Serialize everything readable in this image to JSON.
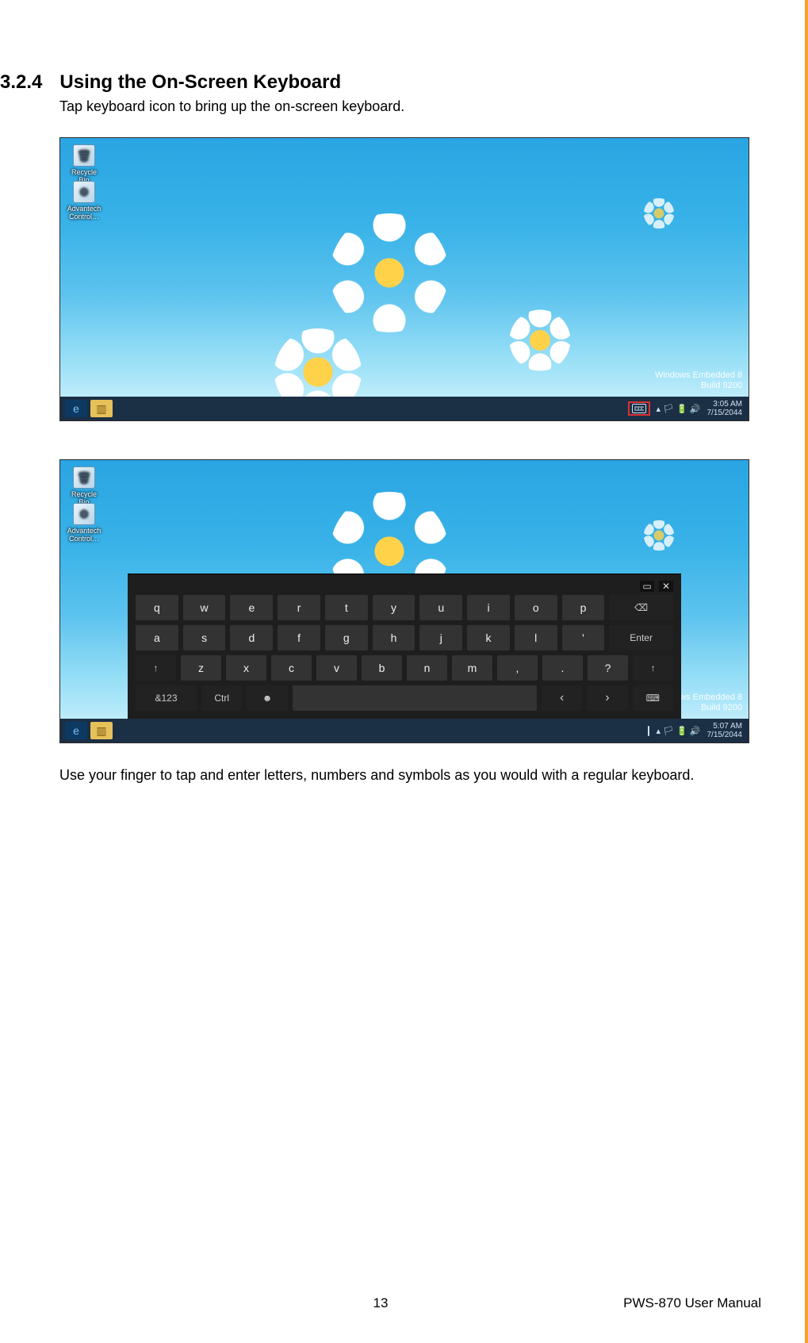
{
  "section": {
    "number": "3.2.4",
    "title": "Using the On-Screen Keyboard"
  },
  "intro": "Tap keyboard icon to bring up the on-screen keyboard.",
  "closing": "Use your finger to tap and enter letters, numbers and symbols as you would with a regular keyboard.",
  "desktop": {
    "icons": [
      {
        "label": "Recycle Bin"
      },
      {
        "label": "Advantech Control…"
      }
    ],
    "watermark_line1": "Windows Embedded 8",
    "watermark_line2": "Build 9200"
  },
  "taskbar1": {
    "time": "3:05 AM",
    "date": "7/15/2044"
  },
  "taskbar2": {
    "time": "5:07 AM",
    "date": "7/15/2044"
  },
  "osk": {
    "row1": [
      "q",
      "w",
      "e",
      "r",
      "t",
      "y",
      "u",
      "i",
      "o",
      "p"
    ],
    "backspace": "⌫",
    "row2": [
      "a",
      "s",
      "d",
      "f",
      "g",
      "h",
      "j",
      "k",
      "l",
      "'"
    ],
    "enter": "Enter",
    "row3_shiftL": "↑",
    "row3": [
      "z",
      "x",
      "c",
      "v",
      "b",
      "n",
      "m",
      ",",
      ".",
      "?"
    ],
    "row3_shiftR": "↑",
    "row4": {
      "sym": "&123",
      "ctrl": "Ctrl",
      "emoji": "☻",
      "space": " ",
      "left": "‹",
      "right": "›",
      "kbd": "⌨"
    }
  },
  "footer": {
    "page": "13",
    "doc": "PWS-870 User Manual"
  }
}
